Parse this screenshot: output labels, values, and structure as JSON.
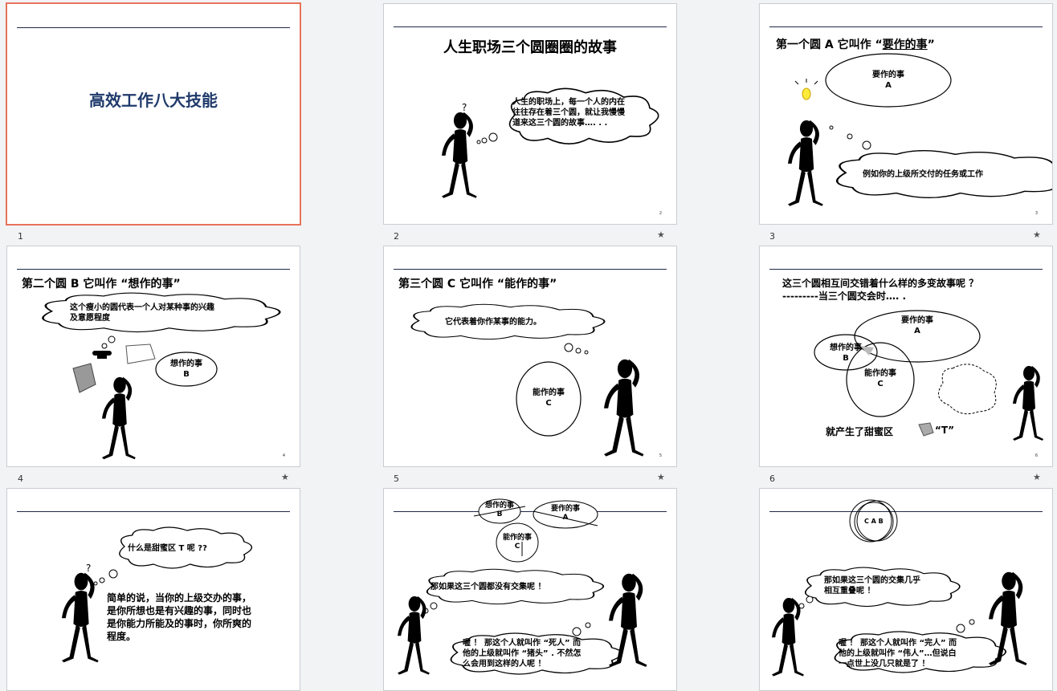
{
  "slides": [
    {
      "number": "1",
      "title": "高效工作八大技能"
    },
    {
      "number": "2",
      "title": "人生职场三个圆圈圈的故事",
      "cloud": "人生的职场上，每一个人的内在往往存在着三个圆，就让我慢慢道来这三个圆的故事…. . .",
      "cloud_l1": "人生的职场上，每一个人的内在",
      "cloud_l2": "往往存在着三个圆，就让我慢慢",
      "cloud_l3": "道来这三个圆的故事…. . .",
      "q": "?",
      "page": "2"
    },
    {
      "number": "3",
      "title_a": "第一个圆 A 它叫作 “",
      "title_b": "要作的事",
      "title_c": "”",
      "oval_l1": "要作的事",
      "oval_l2": "A",
      "cloud": "例如你的上级所交付的任务或工作",
      "page": "3"
    },
    {
      "number": "4",
      "title": "第二个圆 B 它叫作 “想作的事”",
      "cloud_l1": "这个瘦小的圆代表一个人对某种事的兴趣",
      "cloud_l2": "及意愿程度",
      "oval_l1": "想作的事",
      "oval_l2": "B",
      "page": "4"
    },
    {
      "number": "5",
      "title": "第三个圆 C 它叫作 “能作的事”",
      "cloud": "它代表着你作某事的能力。",
      "oval_l1": "能作的事",
      "oval_l2": "C",
      "page": "5"
    },
    {
      "number": "6",
      "line1": "这三个圆相互间交错着什么样的多变故事呢 ？",
      "line2": "---------当三个圆交会时…. .",
      "a_l1": "要作的事",
      "a_l2": "A",
      "b_l1": "想作的事",
      "b_l2": "B",
      "c_l1": "能作的事",
      "c_l2": "C",
      "bottom": "就产生了甜蜜区",
      "t_label": "“T”",
      "page": "6"
    },
    {
      "number": "",
      "cloud": "什么是甜蜜区 T 呢 ??",
      "q": "?",
      "body_l1": "简单的说，当你的上级交办的事，",
      "body_l2": "是你所想也是有兴趣的事，同时也",
      "body_l3": "是你能力所能及的事时，你所爽的",
      "body_l4": "程度。"
    },
    {
      "number": "",
      "b_l1": "想作的事",
      "b_l2": "B",
      "a_l1": "要作的事",
      "a_l2": "A",
      "c_l1": "能作的事",
      "c_l2": "C",
      "cloud1": "那如果这三个圆都没有交集呢 ！",
      "cloud2_l1": "喔 ！ 那这个人就叫作 “死人” 而",
      "cloud2_l2": "他的上级就叫作 “猪头” . 不然怎",
      "cloud2_l3": "么会用到这样的人呢 ！"
    },
    {
      "number": "",
      "circles": "C A B",
      "cloud1_l1": "那如果这三个圆的交集几乎",
      "cloud1_l2": "相互重叠呢 ！",
      "cloud2_l1": "喔 ！ 那这个人就叫作 “完人” 而",
      "cloud2_l2": "他的上级就叫作 “伟人”…但说白",
      "cloud2_l3": "一点世上没几只就是了 ！"
    }
  ],
  "icons": [
    "star-icon",
    "stick-figure-icon",
    "cloud-icon",
    "lightbulb-icon",
    "telephone-icon",
    "question-mark-icon"
  ]
}
